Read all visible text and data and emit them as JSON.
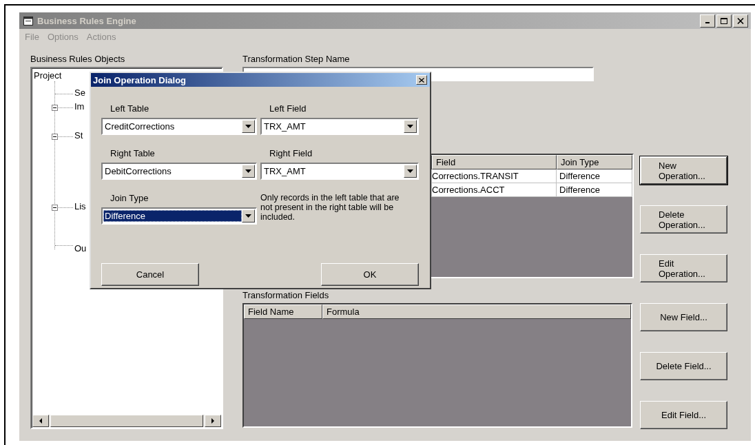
{
  "window": {
    "title": "Business Rules Engine"
  },
  "menu": [
    "File",
    "Options",
    "Actions"
  ],
  "objects_panel": {
    "label": "Business Rules Objects",
    "tree": [
      {
        "label": "Project",
        "children": [
          {
            "label": "Se"
          },
          {
            "label": "Im",
            "expanded": true
          },
          {
            "label": "St",
            "expanded": true
          },
          {
            "label": "Lis",
            "expanded": true
          },
          {
            "label": "Ou"
          }
        ]
      }
    ]
  },
  "step_name": {
    "label": "Transformation Step Name"
  },
  "operations": {
    "columns": [
      "Field",
      "Join Type"
    ],
    "rows": [
      [
        "Corrections.TRANSIT",
        "Difference"
      ],
      [
        "Corrections.ACCT",
        "Difference"
      ]
    ]
  },
  "fields": {
    "label": "Transformation Fields",
    "columns": [
      "Field Name",
      "Formula"
    ]
  },
  "buttons": [
    {
      "label": "New Operation...",
      "default": true
    },
    {
      "label": "Delete Operation...",
      "default": false
    },
    {
      "label": "Edit Operation...",
      "default": false
    },
    {
      "label": "New Field...",
      "default": false
    },
    {
      "label": "Delete Field...",
      "default": false
    },
    {
      "label": "Edit Field...",
      "default": false
    }
  ],
  "dialog": {
    "title": "Join Operation Dialog",
    "fields": [
      {
        "label": "Left Table",
        "value": "CreditCorrections",
        "focused": false
      },
      {
        "label": "Left Field",
        "value": "TRX_AMT",
        "focused": false
      },
      {
        "label": "Right Table",
        "value": "DebitCorrections",
        "focused": false
      },
      {
        "label": "Right Field",
        "value": "TRX_AMT",
        "focused": false
      },
      {
        "label": "Join Type",
        "value": "Difference",
        "focused": true
      }
    ],
    "note": "Only records in the left table that are not present in the right table will be included.",
    "buttons": [
      "Cancel",
      "OK"
    ]
  }
}
